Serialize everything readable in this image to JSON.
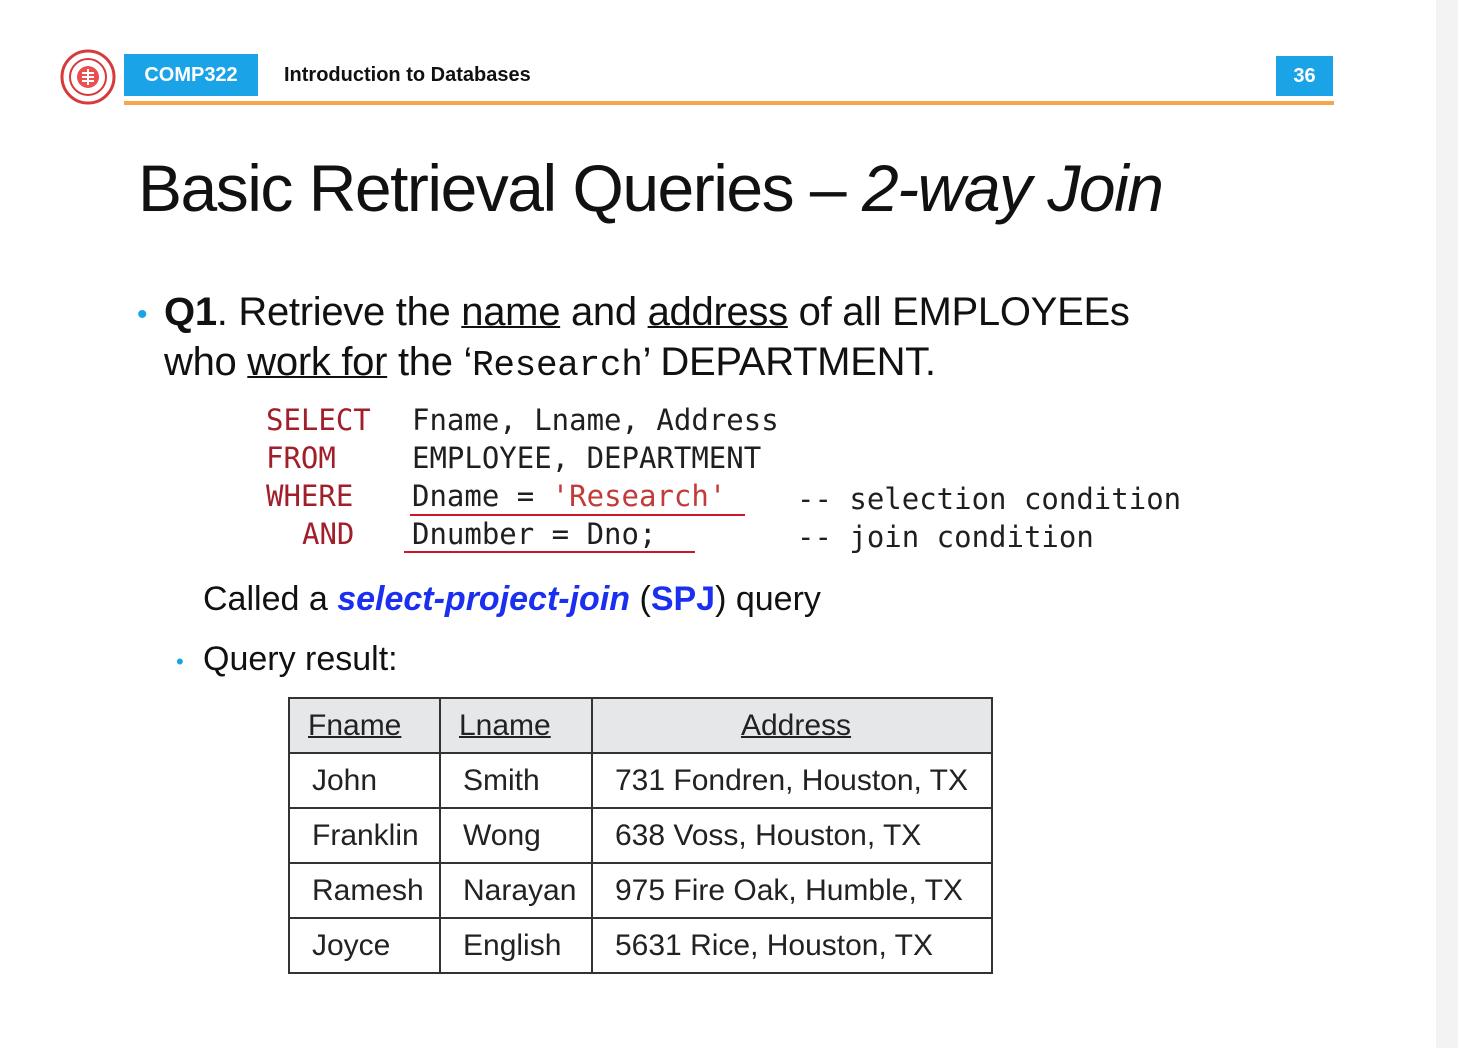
{
  "header": {
    "course_code": "COMP322",
    "course_title": "Introduction to Databases",
    "page_number": "36",
    "logo_icon": "university-seal-icon",
    "accent_color": "#1aa3e6",
    "rule_color": "#f3a64b"
  },
  "slide": {
    "title_main": "Basic Retrieval Queries – ",
    "title_italic": "2-way Join",
    "q1": {
      "label": "Q1",
      "t1": ". Retrieve the ",
      "u1": "name",
      "t2": " and ",
      "u2": "address",
      "t3": " of all EMPLOYEEs",
      "t4": "who ",
      "u3": "work for",
      "t5": " the ‘",
      "mono": "Research",
      "t6": "’ DEPARTMENT."
    },
    "sql": {
      "kw1": "SELECT",
      "v1": "Fname, Lname, Address",
      "kw2": "FROM",
      "v2": "EMPLOYEE, DEPARTMENT",
      "kw3": "WHERE",
      "v3a": "Dname = ",
      "v3b": "'Research'",
      "c3": "-- selection condition",
      "kw4": "AND",
      "v4": "Dnumber = Dno;",
      "c4": "-- join condition"
    },
    "spj": {
      "t1": "Called a ",
      "emph": "select-project-join",
      "t2": " (",
      "abbr": "SPJ",
      "t3": ") query"
    },
    "query_result_label": "Query result:",
    "table": {
      "headers": [
        "Fname",
        "Lname",
        "Address"
      ],
      "rows": [
        [
          "John",
          "Smith",
          "731 Fondren, Houston, TX"
        ],
        [
          "Franklin",
          "Wong",
          "638 Voss, Houston, TX"
        ],
        [
          "Ramesh",
          "Narayan",
          "975 Fire Oak, Humble, TX"
        ],
        [
          "Joyce",
          "English",
          "5631 Rice, Houston, TX"
        ]
      ]
    }
  }
}
